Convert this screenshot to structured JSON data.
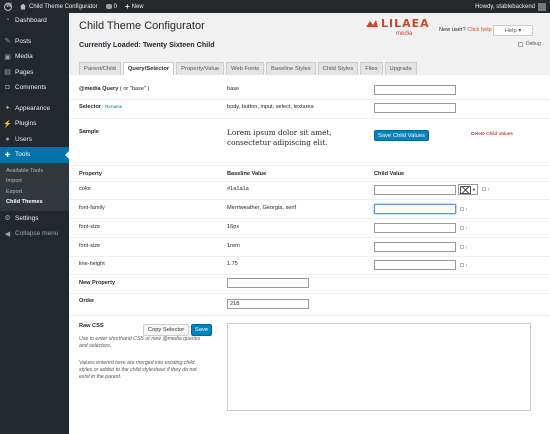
{
  "adminbar": {
    "site_name": "Child Theme Configurator",
    "comments_count": "0",
    "new_label": "New",
    "howdy": "Howdy, stablebackend"
  },
  "sidebar": {
    "items": [
      {
        "label": "Dashboard",
        "icon": "dashboard-icon"
      },
      {
        "label": "Posts",
        "icon": "pin-icon"
      },
      {
        "label": "Media",
        "icon": "media-icon"
      },
      {
        "label": "Pages",
        "icon": "pages-icon"
      },
      {
        "label": "Comments",
        "icon": "comments-icon"
      },
      {
        "label": "Appearance",
        "icon": "appearance-icon"
      },
      {
        "label": "Plugins",
        "icon": "plugins-icon"
      },
      {
        "label": "Users",
        "icon": "users-icon"
      },
      {
        "label": "Tools",
        "icon": "tools-icon"
      },
      {
        "label": "Settings",
        "icon": "settings-icon"
      },
      {
        "label": "Collapse menu",
        "icon": "collapse-icon"
      }
    ],
    "submenu": [
      "Available Tools",
      "Import",
      "Export",
      "Child Themes"
    ]
  },
  "header": {
    "title": "Child Theme Configurator",
    "brand_name": "LILAEA",
    "brand_sub": "media",
    "new_user_text": "New user?",
    "click_here": "Click help",
    "help_label": "Help",
    "loaded": "Currently Loaded: Twenty Sixteen Child",
    "debug_label": "Debug"
  },
  "tabs": [
    "Parent/Child",
    "Query/Selector",
    "Property/Value",
    "Web Fonts",
    "Baseline Styles",
    "Child Styles",
    "Files",
    "Upgrade"
  ],
  "form": {
    "media_query_label": "@media Query",
    "media_query_hint": "( or \"base\" )",
    "media_query_value": "base",
    "selector_label": "Selector",
    "rename_label": "Rename",
    "selector_value": "body, button, input, select, textarea",
    "sample_label": "Sample",
    "sample_text": "Lorem ipsum dolor sit amet, consectetur adipiscing elit.",
    "save_child_values": "Save Child Values",
    "delete_child_values": "Delete Child Values",
    "col_property": "Property",
    "col_baseline": "Baseline Value",
    "col_child": "Child Value",
    "properties": [
      {
        "name": "color",
        "value": "#1a1a1a"
      },
      {
        "name": "font-family",
        "value": "Merriweather, Georgia, serif"
      },
      {
        "name": "font-size",
        "value": "16px"
      },
      {
        "name": "font-size",
        "value": "1rem"
      },
      {
        "name": "line-height",
        "value": "1.75"
      }
    ],
    "new_property_label": "New Property",
    "order_label": "Order",
    "order_value": "218",
    "raw_css_label": "Raw CSS",
    "copy_selector": "Copy Selector",
    "save_label": "Save",
    "raw_note_1": "Use to enter shorthand CSS or new @media queries and selectors.",
    "raw_note_2": "Values entered here are merged into existing child styles or added to the child stylesheet if they do not exist in the parent."
  }
}
